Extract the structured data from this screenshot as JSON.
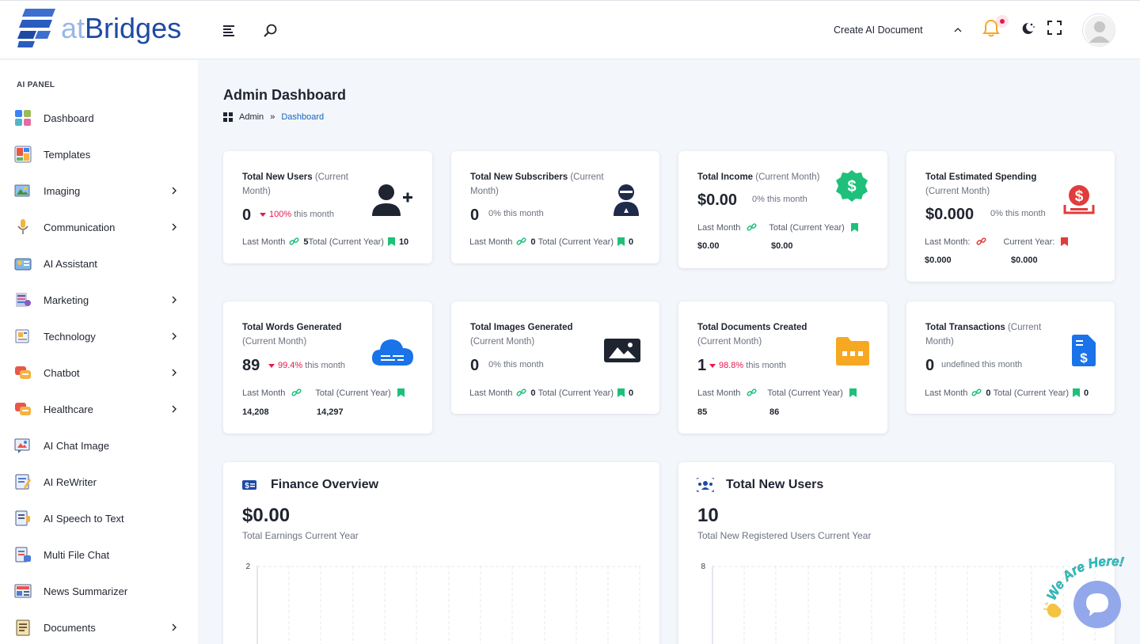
{
  "header": {
    "logo_at": "at",
    "logo_bridges": "Bridges",
    "create_doc_label": "Create AI Document"
  },
  "sidebar": {
    "panel_label": "AI PANEL",
    "items": [
      {
        "label": "Dashboard",
        "icon": "dashboard-icon",
        "expandable": false
      },
      {
        "label": "Templates",
        "icon": "templates-icon",
        "expandable": false
      },
      {
        "label": "Imaging",
        "icon": "imaging-icon",
        "expandable": true
      },
      {
        "label": "Communication",
        "icon": "microphone-icon",
        "expandable": true
      },
      {
        "label": "AI Assistant",
        "icon": "assistant-icon",
        "expandable": false
      },
      {
        "label": "Marketing",
        "icon": "marketing-icon",
        "expandable": true
      },
      {
        "label": "Technology",
        "icon": "technology-icon",
        "expandable": true
      },
      {
        "label": "Chatbot",
        "icon": "chatbot-icon",
        "expandable": true
      },
      {
        "label": "Healthcare",
        "icon": "healthcare-icon",
        "expandable": true
      },
      {
        "label": "AI Chat Image",
        "icon": "chat-image-icon",
        "expandable": false
      },
      {
        "label": "AI ReWriter",
        "icon": "rewriter-icon",
        "expandable": false
      },
      {
        "label": "AI Speech to Text",
        "icon": "speech-icon",
        "expandable": false
      },
      {
        "label": "Multi File Chat",
        "icon": "multi-file-icon",
        "expandable": false
      },
      {
        "label": "News Summarizer",
        "icon": "news-icon",
        "expandable": false
      },
      {
        "label": "Documents",
        "icon": "documents-icon",
        "expandable": true
      }
    ]
  },
  "page": {
    "title": "Admin Dashboard",
    "breadcrumb_root": "Admin",
    "breadcrumb_sep": "»",
    "breadcrumb_current": "Dashboard"
  },
  "cards": {
    "new_users": {
      "title": "Total New Users",
      "sub": "(Current Month)",
      "value": "0",
      "pct": "100%",
      "pct_suffix": "this month",
      "last_label": "Last Month",
      "last_val": "5",
      "total_label": "Total (Current Year)",
      "total_val": "10"
    },
    "new_subs": {
      "title": "Total New Subscribers",
      "sub": "(Current Month)",
      "value": "0",
      "pct": "0%",
      "pct_suffix": "this month",
      "last_label": "Last Month",
      "last_val": "0",
      "total_label": "Total (Current Year)",
      "total_val": "0"
    },
    "income": {
      "title": "Total Income",
      "sub": "(Current Month)",
      "value": "$0.00",
      "pct": "0%",
      "pct_suffix": "this month",
      "last_label": "Last Month",
      "last_val": "$0.00",
      "total_label": "Total (Current Year)",
      "total_val": "$0.00"
    },
    "spending": {
      "title": "Total Estimated Spending",
      "sub": "(Current Month)",
      "value": "$0.000",
      "pct": "0%",
      "pct_suffix": "this month",
      "last_label": "Last Month:",
      "last_val": "$0.000",
      "total_label": "Current Year:",
      "total_val": "$0.000"
    },
    "words": {
      "title": "Total Words Generated",
      "sub": "(Current Month)",
      "value": "89",
      "pct": "99.4%",
      "pct_suffix": "this month",
      "last_label": "Last Month",
      "last_val": "14,208",
      "total_label": "Total (Current Year)",
      "total_val": "14,297"
    },
    "images": {
      "title": "Total Images Generated",
      "sub": "(Current Month)",
      "value": "0",
      "pct": "0%",
      "pct_suffix": "this month",
      "last_label": "Last Month",
      "last_val": "0",
      "total_label": "Total (Current Year)",
      "total_val": "0"
    },
    "documents": {
      "title": "Total Documents Created",
      "sub": "(Current Month)",
      "value": "1",
      "pct": "98.8%",
      "pct_suffix": "this month",
      "last_label": "Last Month",
      "last_val": "85",
      "total_label": "Total (Current Year)",
      "total_val": "86"
    },
    "transactions": {
      "title": "Total Transactions",
      "sub": "(Current Month)",
      "value": "0",
      "pct": "undefined",
      "pct_suffix": "this month",
      "last_label": "Last Month",
      "last_val": "0",
      "total_label": "Total (Current Year)",
      "total_val": "0"
    }
  },
  "finance": {
    "title": "Finance Overview",
    "value": "$0.00",
    "sub": "Total Earnings Current Year",
    "ytick_top": "2"
  },
  "users_chart": {
    "title": "Total New Users",
    "value": "10",
    "sub": "Total New Registered Users Current Year",
    "ytick_top": "8"
  },
  "chat_widget": {
    "label": "We Are Here!"
  },
  "colors": {
    "accent": "#1566c0",
    "negative": "#e8184d",
    "green": "#1ec07a",
    "red": "#e23b3b",
    "blue": "#1a73e8",
    "orange": "#f7a823",
    "navy": "#1e2a4a"
  }
}
